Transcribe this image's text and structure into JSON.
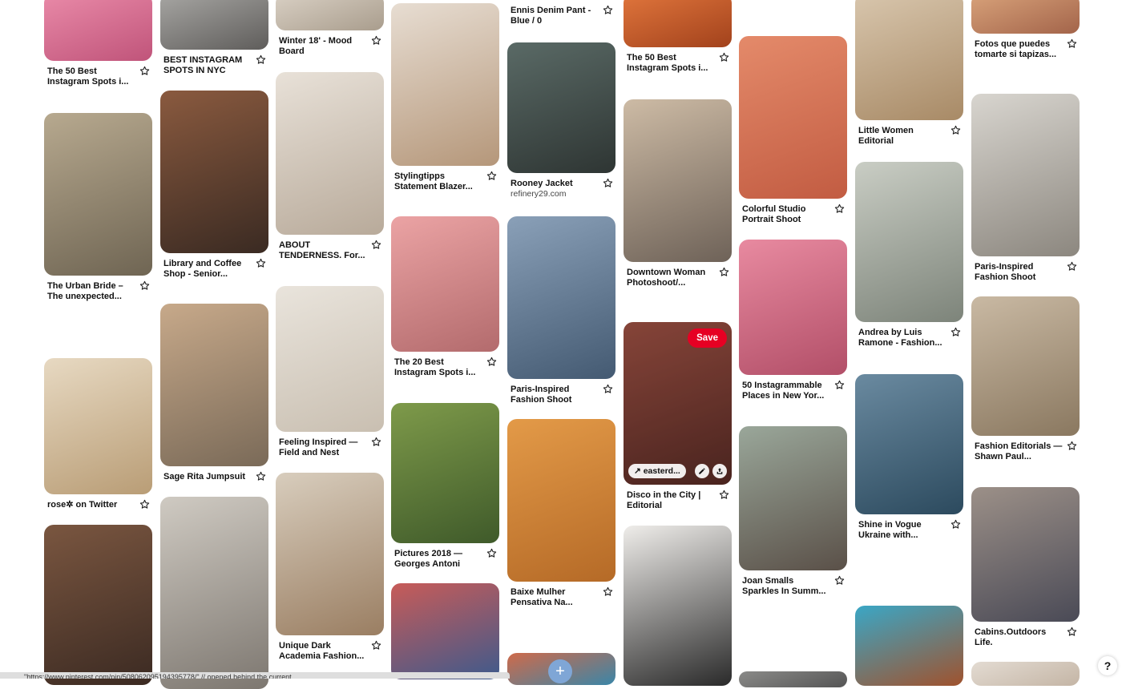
{
  "save_label": "Save",
  "status_url": "\"https://www.pinterest.com/pin/508062095194395778/\" // opened behind the current",
  "help_label": "?",
  "add_label": "+",
  "overlay": {
    "link": "↗ easterd...",
    "edit_icon": "pencil-icon",
    "share_icon": "share-icon"
  },
  "columns": [
    {
      "pins": [
        {
          "title": "The 50 Best\nInstagram Spots i...",
          "colors": [
            "#e98aa8",
            "#c0547a"
          ]
        },
        {
          "title": "The Urban Bride –\nThe unexpected...",
          "colors": [
            "#b7a98f",
            "#6f6553"
          ]
        },
        {
          "title": "rose✲ on Twitter",
          "colors": [
            "#e7d9c2",
            "#b99d76"
          ]
        },
        {
          "title": "",
          "colors": [
            "#7a5640",
            "#3b2a22"
          ]
        }
      ]
    },
    {
      "pins": [
        {
          "title": "BEST INSTAGRAM\nSPOTS IN NYC",
          "colors": [
            "#a7a6a3",
            "#5f5d5b"
          ]
        },
        {
          "title": "Library and Coffee\nShop - Senior...",
          "colors": [
            "#8a5a3f",
            "#3a2a22"
          ]
        },
        {
          "title": "Sage Rita Jumpsuit",
          "colors": [
            "#c7a98a",
            "#7a6a58"
          ]
        },
        {
          "title": "",
          "colors": [
            "#cfcac2",
            "#7d7770"
          ]
        }
      ]
    },
    {
      "pins": [
        {
          "title": "Winter 18' - Mood\nBoard",
          "colors": [
            "#d9d0c4",
            "#a99d8d"
          ]
        },
        {
          "title": "ABOUT\nTENDERNESS. For...",
          "colors": [
            "#e8e1d8",
            "#b8aa9a"
          ]
        },
        {
          "title": "Feeling Inspired —\nField and Nest",
          "colors": [
            "#e9e4dc",
            "#c9bfb1"
          ]
        },
        {
          "title": "Unique Dark\nAcademia Fashion...",
          "colors": [
            "#d8cdbd",
            "#9a7e62"
          ]
        }
      ]
    },
    {
      "pins": [
        {
          "title": "Stylingtipps\nStatement Blazer...",
          "colors": [
            "#e7ddd2",
            "#b5977a"
          ]
        },
        {
          "title": "The 20 Best\nInstagram Spots i...",
          "colors": [
            "#eba3a4",
            "#b36b6d"
          ]
        },
        {
          "title": "Pictures 2018 —\nGeorges Antoni",
          "colors": [
            "#7e9a4a",
            "#3f5a2a"
          ]
        },
        {
          "title": "",
          "colors": [
            "#c85b58",
            "#3e5a8c"
          ]
        }
      ]
    },
    {
      "pins": [
        {
          "title": "Ennis Denim Pant -\nBlue / 0",
          "colors": [
            "#e6e2dc",
            "#bcb5ab"
          ]
        },
        {
          "title": "Rooney Jacket",
          "subtitle": "refinery29.com",
          "colors": [
            "#5a6a66",
            "#2e3533"
          ]
        },
        {
          "title": "Paris-Inspired\nFashion Shoot",
          "colors": [
            "#8aa0b8",
            "#445a72"
          ]
        },
        {
          "title": "Baixe Mulher\nPensativa Na...",
          "colors": [
            "#e39a48",
            "#b56a27"
          ]
        },
        {
          "title": "",
          "colors": [
            "#cf6a4a",
            "#3a86a8"
          ]
        }
      ]
    },
    {
      "pins": [
        {
          "title": "The 50 Best\nInstagram Spots i...",
          "colors": [
            "#e0753c",
            "#a2421c"
          ]
        },
        {
          "title": "Downtown Woman\nPhotoshoot/...",
          "colors": [
            "#cdbba5",
            "#6e6258"
          ]
        },
        {
          "title": "Disco in the City |\nEditorial",
          "colors": [
            "#a45446",
            "#5a2c26"
          ],
          "hovered": true
        },
        {
          "title": "",
          "colors": [
            "#efedea",
            "#2a2a2a"
          ]
        }
      ]
    },
    {
      "pins": [
        {
          "title": "Colorful Studio\nPortrait Shoot",
          "colors": [
            "#e48a6a",
            "#c25c42"
          ]
        },
        {
          "title": "50 Instagrammable\nPlaces in New Yor...",
          "colors": [
            "#e88aa0",
            "#b24f68"
          ]
        },
        {
          "title": "Joan Smalls\nSparkles In Summ...",
          "colors": [
            "#9aa79a",
            "#5a5048"
          ]
        },
        {
          "title": "",
          "colors": [
            "#8a8a88",
            "#555"
          ]
        }
      ]
    },
    {
      "pins": [
        {
          "title": "Little Women\nEditorial",
          "colors": [
            "#d8c6ad",
            "#a88a66"
          ]
        },
        {
          "title": "Andrea by Luis\nRamone - Fashion...",
          "colors": [
            "#c9cdc4",
            "#7d847a"
          ]
        },
        {
          "title": "Shine in Vogue\nUkraine with...",
          "colors": [
            "#6a8aa0",
            "#2c4a5e"
          ]
        },
        {
          "title": "",
          "colors": [
            "#3aa7c6",
            "#a0522d"
          ]
        }
      ]
    },
    {
      "pins": [
        {
          "title": "Fotos que puedes\ntomarte si tapizas...",
          "colors": [
            "#d8a27a",
            "#a3644a"
          ]
        },
        {
          "title": "Paris-Inspired\nFashion Shoot",
          "colors": [
            "#d8d5cf",
            "#8c877f"
          ]
        },
        {
          "title": "Fashion Editorials —\nShawn Paul...",
          "colors": [
            "#c9b9a3",
            "#8a7860"
          ]
        },
        {
          "title": "Cabins.Outdoors\nLife.",
          "colors": [
            "#9c9088",
            "#4a4a56"
          ]
        },
        {
          "title": "",
          "colors": [
            "#e3dbd2",
            "#c4b5a5"
          ]
        }
      ]
    }
  ]
}
